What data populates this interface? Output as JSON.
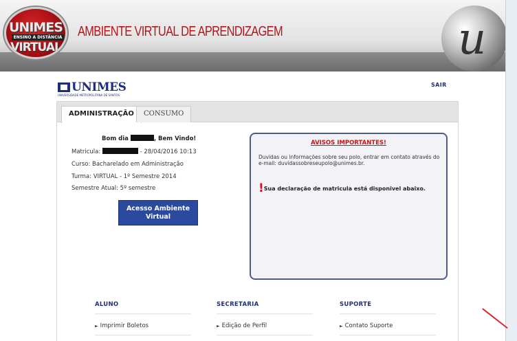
{
  "header": {
    "logo_top": "UNIMES",
    "logo_mid": "ENSINO A DISTÂNCIA",
    "logo_bottom": "VIRTUAL",
    "title": "AMBIENTE VIRTUAL DE APRENDIZAGEM",
    "globe_letter": "u"
  },
  "brand": {
    "name": "UNIMES",
    "subtitle": "UNIVERSIDADE METROPOLITANA DE SANTOS"
  },
  "logout_label": "SAIR",
  "tabs": [
    {
      "label": "ADMINISTRAÇÃO",
      "active": true
    },
    {
      "label": "CONSUMO",
      "active": false
    }
  ],
  "student": {
    "greeting_prefix": "Bom dia",
    "greeting_suffix": ", Bem Vindo!",
    "matricula_label": "Matricula:",
    "matricula_date": "- 28/04/2016 10:13",
    "curso": "Curso: Bacharelado em Administração",
    "turma": "Turma: VIRTUAL - 1º Semestre 2014",
    "semestre": "Semestre Atual: 5º semestre"
  },
  "access_button": "Acesso Ambiente Virtual",
  "notice": {
    "title": "AVISOS IMPORTANTES!",
    "text": "Duvidas ou informações sobre seu polo, entrar em contato através do e-mail: duvidassobreseupolo@unimes.br.",
    "alert": "Sua declaração de matricula está disponivel abaixo."
  },
  "columns": [
    {
      "title": "ALUNO",
      "link": "Imprimir Boletos"
    },
    {
      "title": "SECRETARIA",
      "link": "Edição de Perfil"
    },
    {
      "title": "SUPORTE",
      "link": "Contato Suporte"
    }
  ],
  "colors": {
    "brand_blue": "#1f2f7a",
    "accent_red": "#b0171c",
    "button_blue": "#2b4a9e"
  }
}
